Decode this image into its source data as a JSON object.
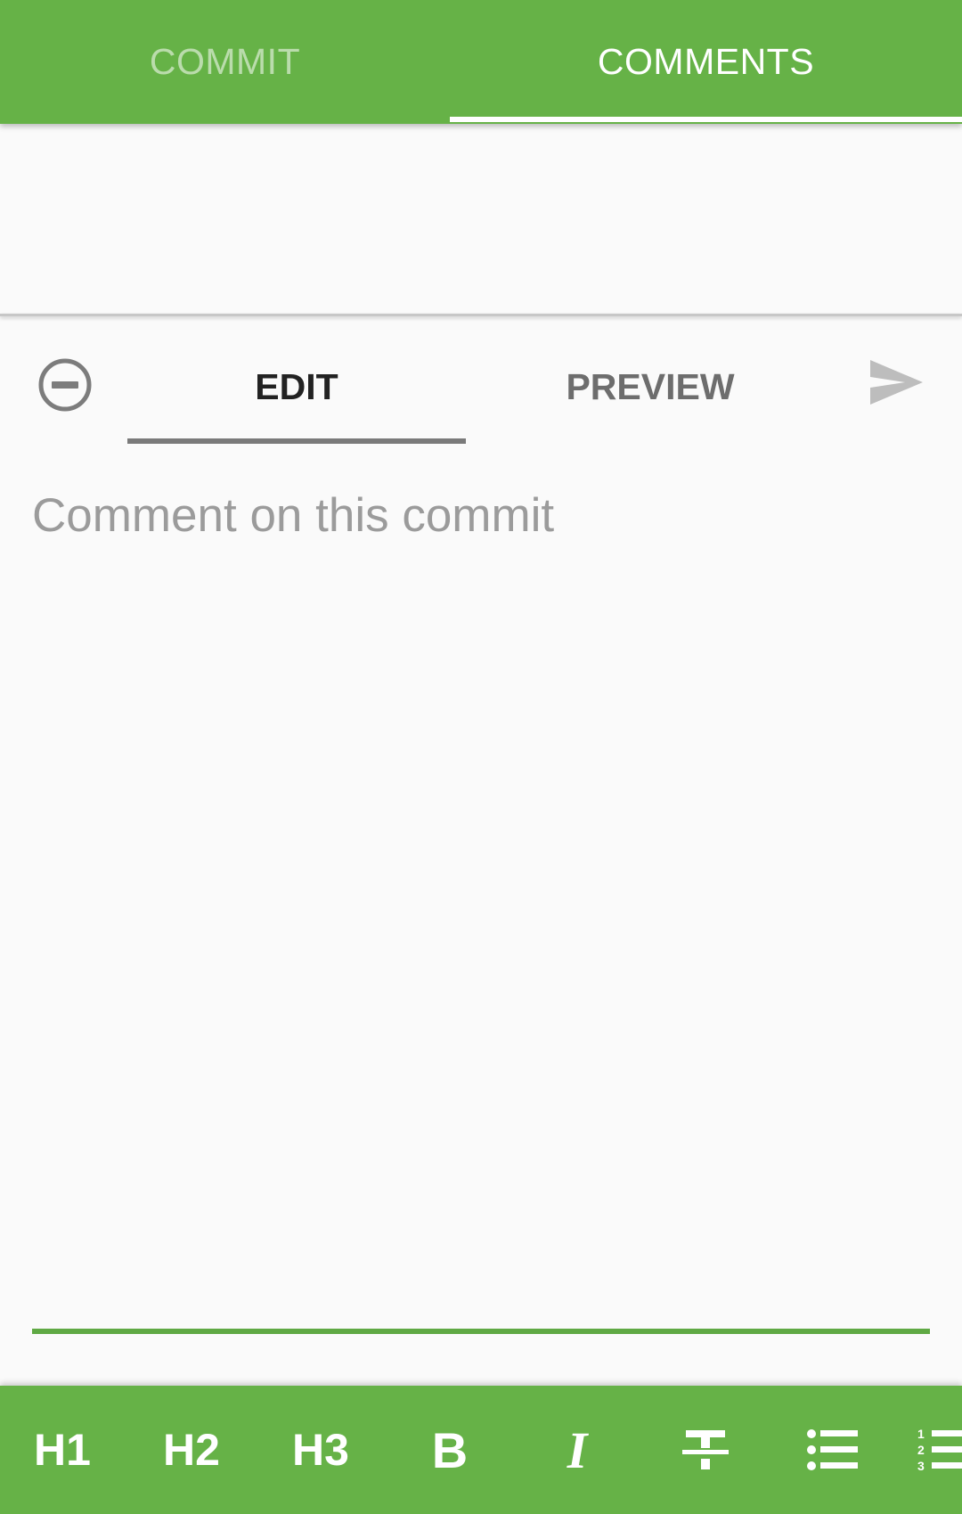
{
  "top_tabs": [
    {
      "label": "COMMIT"
    },
    {
      "label": "COMMENTS"
    }
  ],
  "top_tabs_selected": "COMMENTS",
  "editor": {
    "tabs": [
      {
        "label": "EDIT"
      },
      {
        "label": "PREVIEW"
      }
    ],
    "selected_tab": "EDIT",
    "cancel_icon": "remove-circle-icon",
    "send_icon": "send-icon",
    "comment_placeholder": "Comment on this commit",
    "comment_value": ""
  },
  "format_toolbar": {
    "buttons": [
      {
        "label": "H1",
        "icon": "heading-1-icon"
      },
      {
        "label": "H2",
        "icon": "heading-2-icon"
      },
      {
        "label": "H3",
        "icon": "heading-3-icon"
      },
      {
        "label": "B",
        "icon": "bold-icon"
      },
      {
        "label": "I",
        "icon": "italic-icon"
      },
      {
        "label": "",
        "icon": "strikethrough-icon"
      },
      {
        "label": "",
        "icon": "bulleted-list-icon"
      },
      {
        "label": "",
        "icon": "numbered-list-icon"
      }
    ]
  },
  "colors": {
    "accent": "#66b247",
    "input_underline": "#5fa944",
    "background": "#fafafa"
  }
}
